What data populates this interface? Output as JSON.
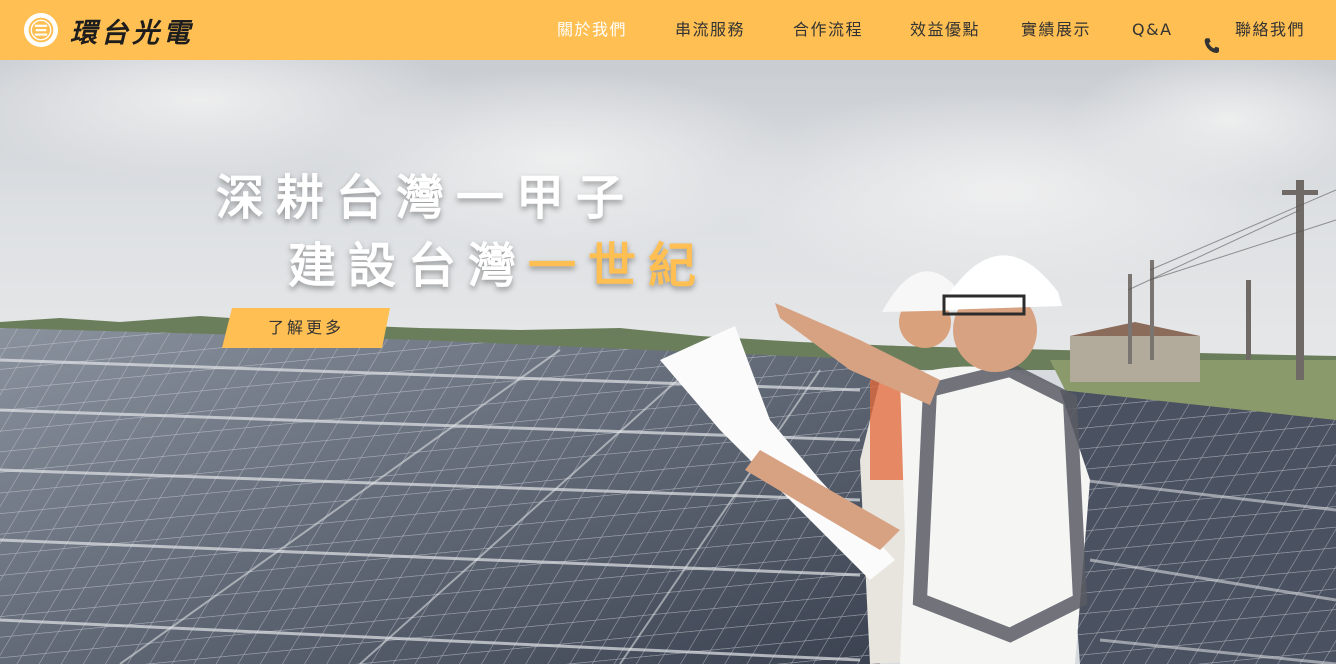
{
  "brand": {
    "name": "環台光電",
    "logo_icon": "circle-emblem-icon"
  },
  "nav": {
    "items": [
      {
        "label": "關於我們",
        "active": true
      },
      {
        "label": "串流服務",
        "active": false
      },
      {
        "label": "合作流程",
        "active": false
      },
      {
        "label": "效益優點",
        "active": false
      },
      {
        "label": "實績展示",
        "active": false
      },
      {
        "label": "Q&A",
        "active": false
      }
    ],
    "contact_label": "聯絡我們",
    "contact_icon": "phone-icon"
  },
  "hero": {
    "headline_line1": "深耕台灣一甲子",
    "headline_line2_main": "建設台灣",
    "headline_line2_accent": "一世紀",
    "cta_label": "了解更多",
    "image": "workers-with-blueprint-at-solar-farm"
  },
  "colors": {
    "brand_yellow": "#ffbf52",
    "nav_text": "#333333",
    "nav_active": "#ffffff",
    "headline": "#ffffff",
    "accent": "#ffbf52"
  }
}
